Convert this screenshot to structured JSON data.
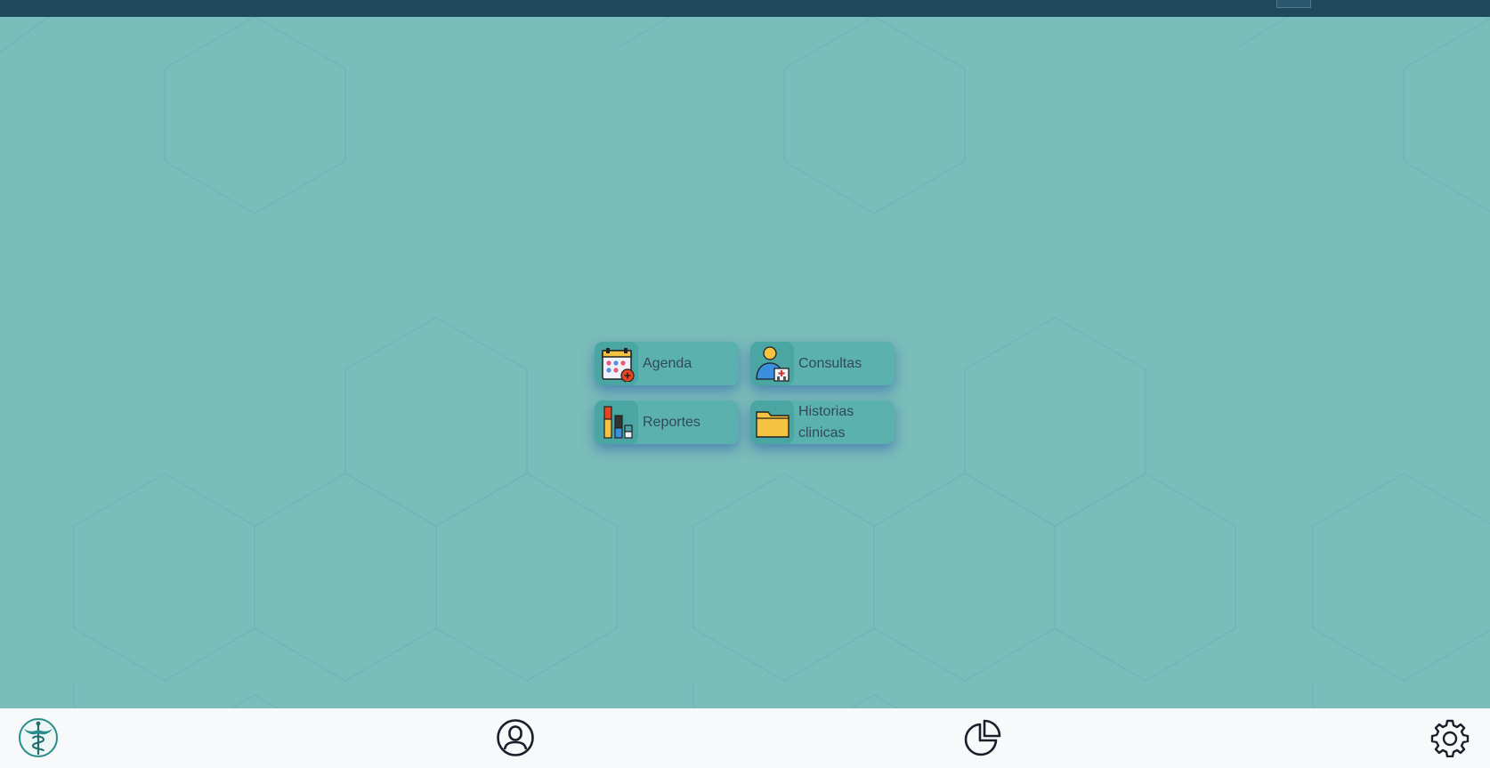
{
  "menu": {
    "items": [
      {
        "label": "Agenda",
        "icon": "calendar-add-icon"
      },
      {
        "label": "Consultas",
        "icon": "patient-hospital-icon"
      },
      {
        "label": "Reportes",
        "icon": "bar-chart-icon"
      },
      {
        "label": "Historias clinicas",
        "icon": "folder-icon"
      }
    ]
  },
  "bottom_nav": {
    "items": [
      {
        "icon": "caduceus-logo-icon"
      },
      {
        "icon": "user-circle-icon"
      },
      {
        "icon": "pie-chart-icon"
      },
      {
        "icon": "gear-icon"
      }
    ]
  },
  "colors": {
    "top_bar": "#1f4a5e",
    "background": "#7bbdba",
    "tile": "#5bb1ae",
    "bottom_bar": "#f8f9fb",
    "accent": "#2a8c8a"
  }
}
